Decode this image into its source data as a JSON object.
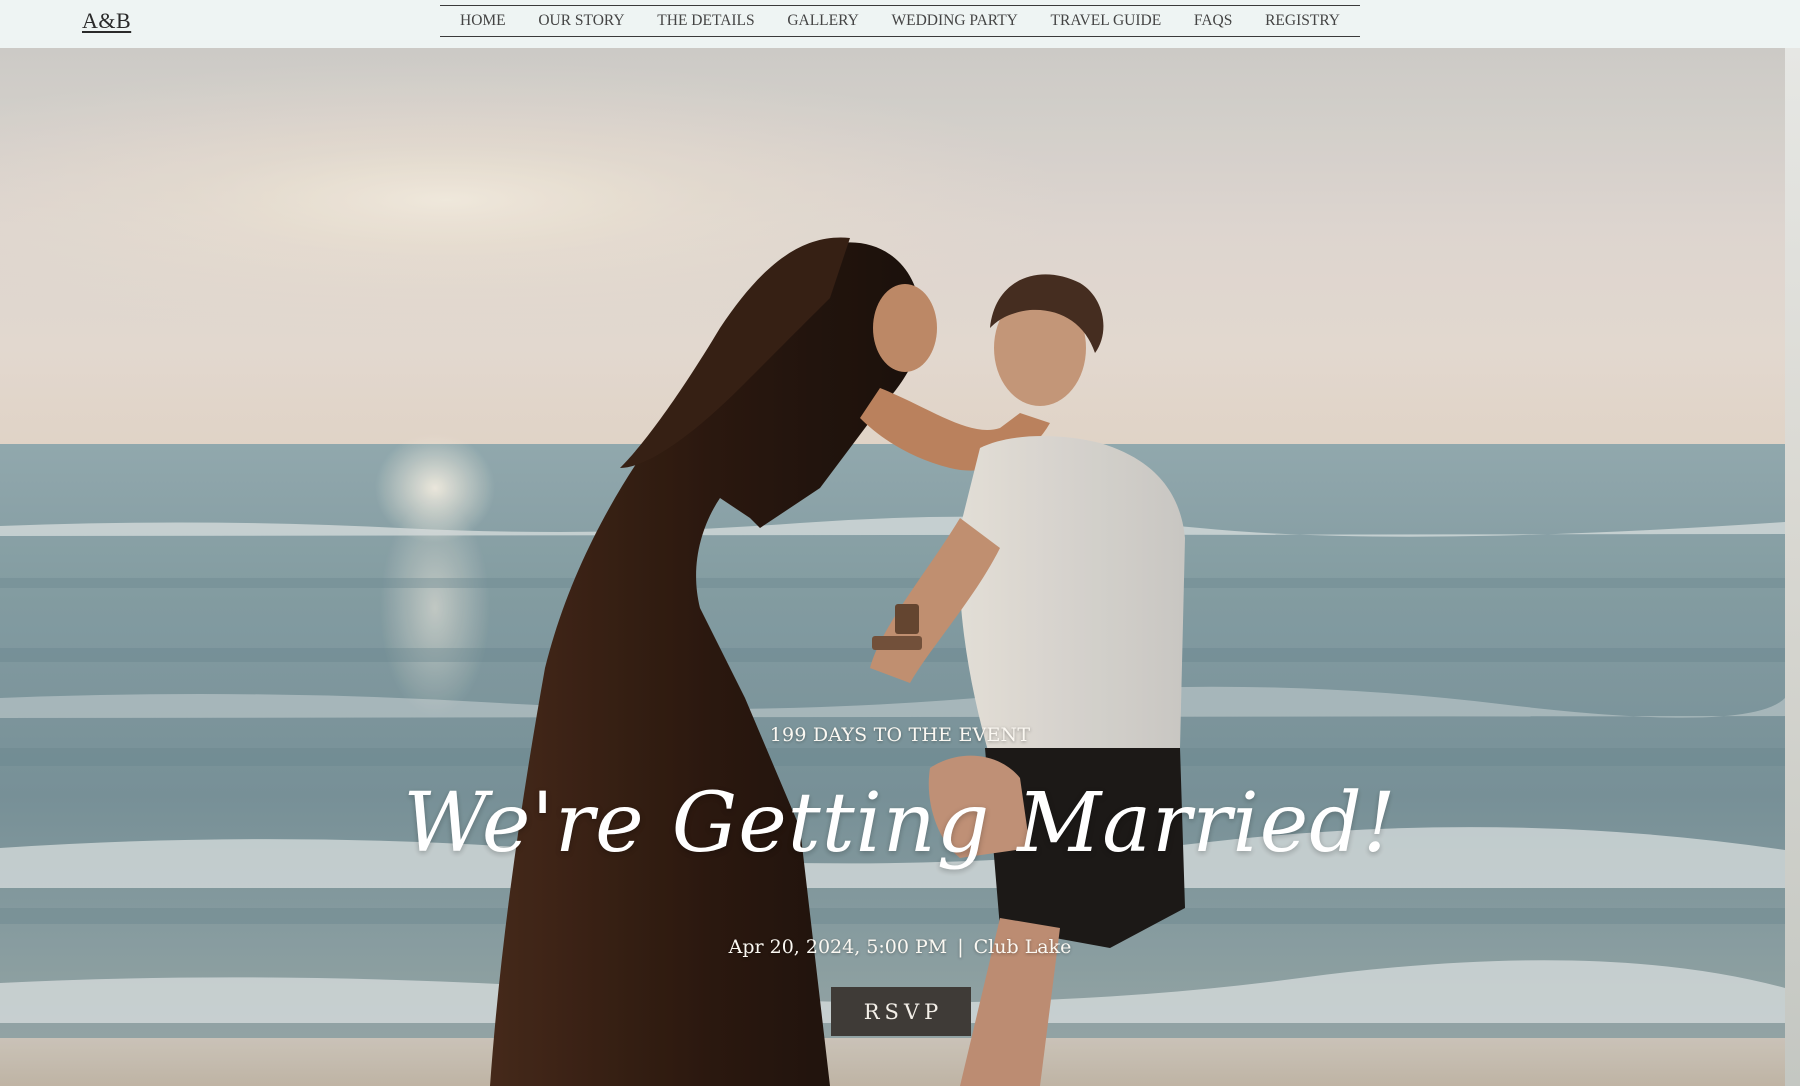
{
  "header": {
    "logo": "A&B",
    "nav": [
      "HOME",
      "OUR STORY",
      "THE DETAILS",
      "GALLERY",
      "WEDDING PARTY",
      "TRAVEL GUIDE",
      "FAQs",
      "REGISTRY"
    ]
  },
  "hero": {
    "countdown": "199 DAYS TO THE EVENT",
    "headline": "We're Getting Married!",
    "event_datetime": "Apr 20, 2024, 5:00 PM",
    "event_separator": "|",
    "event_location": "Club Lake",
    "rsvp_label": "RSVP"
  },
  "colors": {
    "header_bg": "#eef4f3",
    "rsvp_bg": "#3f3b37",
    "sky_top": "#dcdcd9",
    "sea": "#8fa7ad",
    "sand": "#d8cdbf"
  }
}
